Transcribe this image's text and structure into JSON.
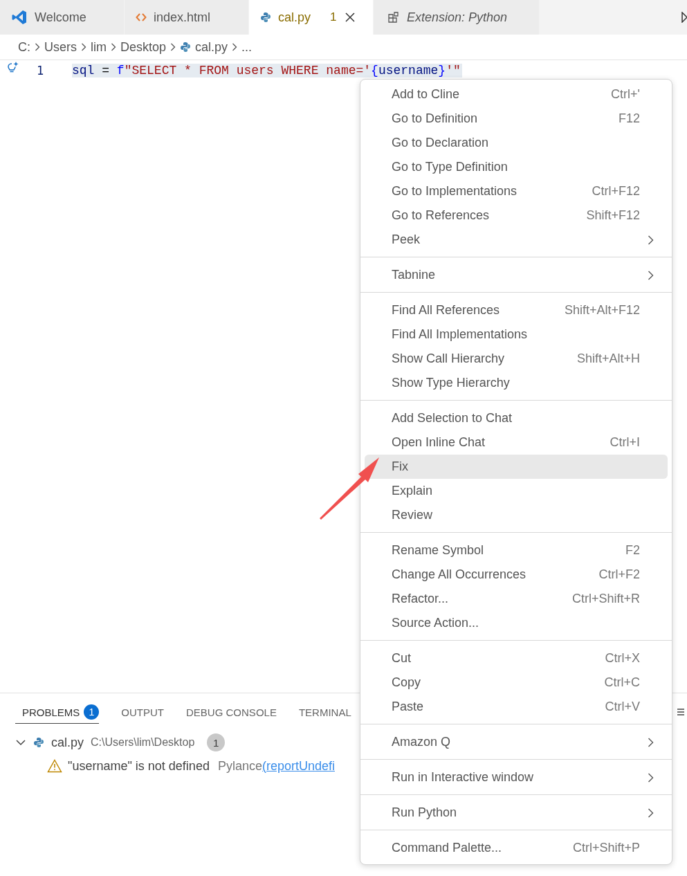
{
  "tabs": [
    {
      "kind": "welcome",
      "label": "Welcome",
      "selected": false,
      "preview": false
    },
    {
      "kind": "html",
      "label": "index.html",
      "selected": false,
      "preview": false
    },
    {
      "kind": "python",
      "label": "cal.py",
      "selected": true,
      "preview": false,
      "badge": "1"
    },
    {
      "kind": "extension",
      "label": "Extension: Python",
      "selected": false,
      "preview": true
    }
  ],
  "breadcrumb": [
    {
      "kind": "folder",
      "label": "C:"
    },
    {
      "kind": "folder",
      "label": "Users"
    },
    {
      "kind": "folder",
      "label": "lim"
    },
    {
      "kind": "folder",
      "label": "Desktop"
    },
    {
      "kind": "python",
      "label": "cal.py"
    },
    {
      "kind": "more",
      "label": "..."
    }
  ],
  "editor": {
    "line_number": "1",
    "tokens": [
      {
        "kind": "name",
        "text": "sql"
      },
      {
        "kind": "op",
        "text": " = "
      },
      {
        "kind": "prefix",
        "text": "f"
      },
      {
        "kind": "string",
        "text": "\"SELECT * FROM users WHERE name='"
      },
      {
        "kind": "brace",
        "text": "{"
      },
      {
        "kind": "name",
        "text": "username"
      },
      {
        "kind": "brace",
        "text": "}"
      },
      {
        "kind": "string",
        "text": "'\""
      }
    ]
  },
  "context_menu": [
    [
      {
        "kind": "command",
        "label": "Add to Cline",
        "shortcut": "Ctrl+'",
        "selected": false
      },
      {
        "kind": "command",
        "label": "Go to Definition",
        "shortcut": "F12",
        "selected": false
      },
      {
        "kind": "command",
        "label": "Go to Declaration",
        "selected": false
      },
      {
        "kind": "command",
        "label": "Go to Type Definition",
        "selected": false
      },
      {
        "kind": "command",
        "label": "Go to Implementations",
        "shortcut": "Ctrl+F12",
        "selected": false
      },
      {
        "kind": "command",
        "label": "Go to References",
        "shortcut": "Shift+F12",
        "selected": false
      },
      {
        "kind": "submenu",
        "label": "Peek",
        "selected": false
      }
    ],
    [
      {
        "kind": "submenu",
        "label": "Tabnine",
        "selected": false
      }
    ],
    [
      {
        "kind": "command",
        "label": "Find All References",
        "shortcut": "Shift+Alt+F12",
        "selected": false
      },
      {
        "kind": "command",
        "label": "Find All Implementations",
        "selected": false
      },
      {
        "kind": "command",
        "label": "Show Call Hierarchy",
        "shortcut": "Shift+Alt+H",
        "selected": false
      },
      {
        "kind": "command",
        "label": "Show Type Hierarchy",
        "selected": false
      }
    ],
    [
      {
        "kind": "command",
        "label": "Add Selection to Chat",
        "selected": false
      },
      {
        "kind": "command",
        "label": "Open Inline Chat",
        "shortcut": "Ctrl+I",
        "selected": false
      },
      {
        "kind": "command",
        "label": "Fix",
        "selected": true
      },
      {
        "kind": "command",
        "label": "Explain",
        "selected": false
      },
      {
        "kind": "command",
        "label": "Review",
        "selected": false
      }
    ],
    [
      {
        "kind": "command",
        "label": "Rename Symbol",
        "shortcut": "F2",
        "selected": false
      },
      {
        "kind": "command",
        "label": "Change All Occurrences",
        "shortcut": "Ctrl+F2",
        "selected": false
      },
      {
        "kind": "command",
        "label": "Refactor...",
        "shortcut": "Ctrl+Shift+R",
        "selected": false
      },
      {
        "kind": "command",
        "label": "Source Action...",
        "selected": false
      }
    ],
    [
      {
        "kind": "command",
        "label": "Cut",
        "shortcut": "Ctrl+X",
        "selected": false
      },
      {
        "kind": "command",
        "label": "Copy",
        "shortcut": "Ctrl+C",
        "selected": false
      },
      {
        "kind": "command",
        "label": "Paste",
        "shortcut": "Ctrl+V",
        "selected": false
      }
    ],
    [
      {
        "kind": "submenu",
        "label": "Amazon Q",
        "selected": false
      }
    ],
    [
      {
        "kind": "submenu",
        "label": "Run in Interactive window",
        "selected": false
      }
    ],
    [
      {
        "kind": "submenu",
        "label": "Run Python",
        "selected": false
      }
    ],
    [
      {
        "kind": "command",
        "label": "Command Palette...",
        "shortcut": "Ctrl+Shift+P",
        "selected": false
      }
    ]
  ],
  "panel": {
    "tabs": [
      {
        "label": "PROBLEMS",
        "selected": true,
        "badge": "1"
      },
      {
        "label": "OUTPUT",
        "selected": false
      },
      {
        "label": "DEBUG CONSOLE",
        "selected": false
      },
      {
        "label": "TERMINAL",
        "selected": false
      }
    ],
    "problems": [
      {
        "file": "cal.py",
        "path": "C:\\Users\\lim\\Desktop",
        "count": "1",
        "expanded": true,
        "children": [
          {
            "message": "\"username\" is not defined",
            "source": "Pylance",
            "code": "(reportUndefi"
          }
        ]
      }
    ]
  }
}
